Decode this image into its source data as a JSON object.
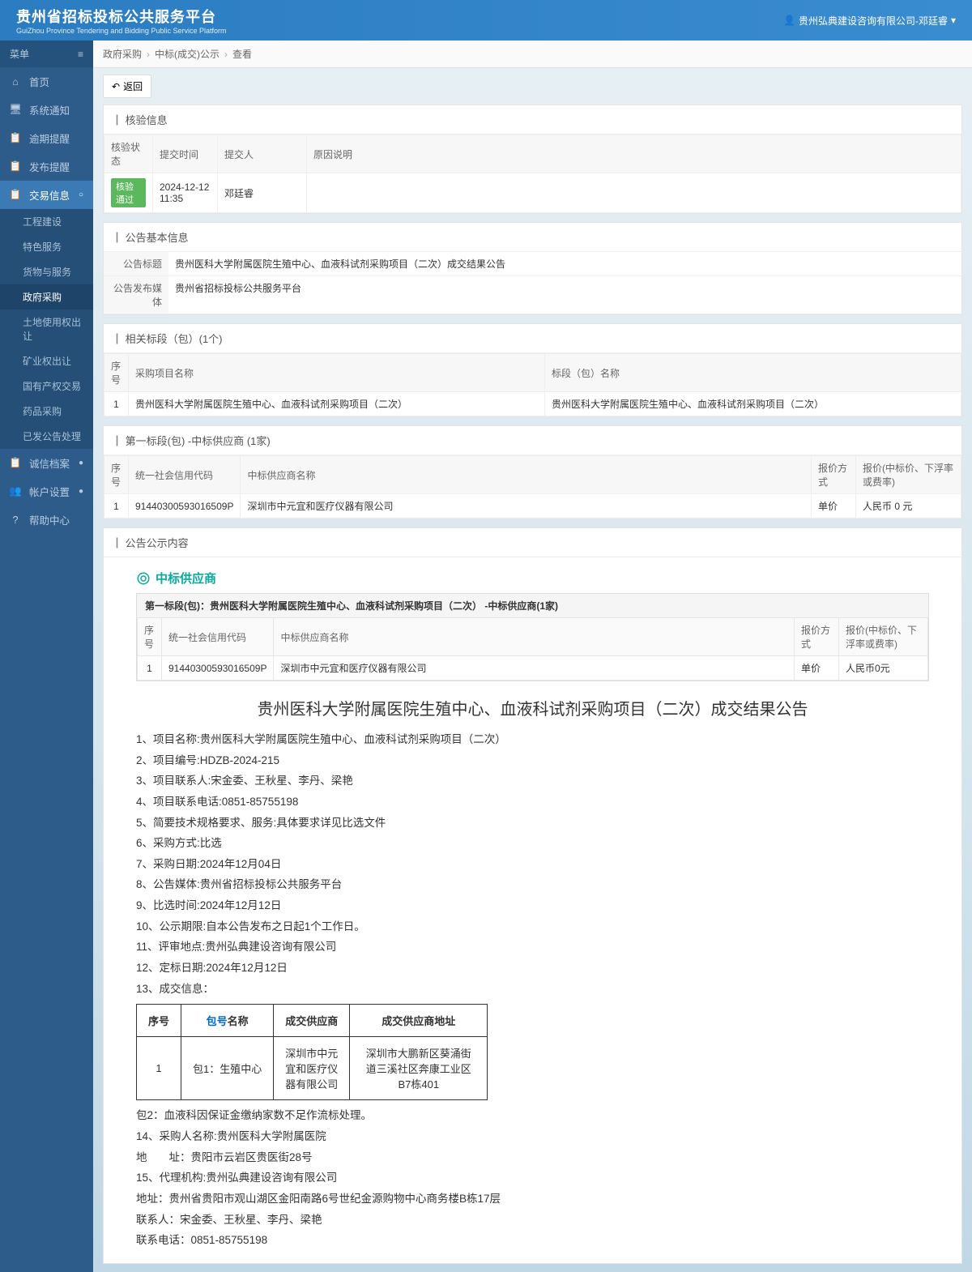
{
  "header": {
    "title": "贵州省招标投标公共服务平台",
    "subtitle": "GuiZhou Province Tendering and Bidding Public Service Platform",
    "user": "贵州弘典建设咨询有限公司-邓廷睿"
  },
  "sidebar": {
    "menuLabel": "菜单",
    "items": [
      {
        "label": "首页"
      },
      {
        "label": "系统通知"
      },
      {
        "label": "逾期提醒"
      },
      {
        "label": "发布提醒"
      },
      {
        "label": "交易信息",
        "active": true,
        "expand": "○"
      },
      {
        "label": "诚信档案",
        "expand": "●"
      },
      {
        "label": "帐户设置",
        "expand": "●"
      },
      {
        "label": "帮助中心"
      }
    ],
    "submenu": [
      {
        "label": "工程建设"
      },
      {
        "label": "特色服务"
      },
      {
        "label": "货物与服务"
      },
      {
        "label": "政府采购",
        "active": true
      },
      {
        "label": "土地使用权出让"
      },
      {
        "label": "矿业权出让"
      },
      {
        "label": "国有产权交易"
      },
      {
        "label": "药品采购"
      },
      {
        "label": "已发公告处理"
      }
    ]
  },
  "breadcrumb": [
    "政府采购",
    "中标(成交)公示",
    "查看"
  ],
  "backBtn": "返回",
  "verify": {
    "title": "核验信息",
    "headers": [
      "核验状态",
      "提交时间",
      "提交人",
      "原因说明"
    ],
    "row": {
      "status": "核验通过",
      "time": "2024-12-12 11:35",
      "person": "邓廷睿",
      "reason": ""
    }
  },
  "basic": {
    "title": "公告基本信息",
    "rows": [
      {
        "label": "公告标题",
        "value": "贵州医科大学附属医院生殖中心、血液科试剂采购项目（二次）成交结果公告"
      },
      {
        "label": "公告发布媒体",
        "value": "贵州省招标投标公共服务平台"
      }
    ]
  },
  "sections": {
    "title": "相关标段（包）(1个)",
    "headers": [
      "序号",
      "采购项目名称",
      "标段（包）名称"
    ],
    "row": [
      "1",
      "贵州医科大学附属医院生殖中心、血液科试剂采购项目（二次）",
      "贵州医科大学附属医院生殖中心、血液科试剂采购项目（二次）"
    ]
  },
  "winner": {
    "title": "第一标段(包) -中标供应商 (1家)",
    "headers": [
      "序号",
      "统一社会信用代码",
      "中标供应商名称",
      "报价方式",
      "报价(中标价、下浮率或费率)"
    ],
    "row": [
      "1",
      "91440300593016509P",
      "深圳市中元宜和医疗仪器有限公司",
      "单价",
      "人民币 0 元"
    ]
  },
  "publish": {
    "title": "公告公示内容",
    "supplierBadge": "中标供应商",
    "boxTitle": "第一标段(包)：贵州医科大学附属医院生殖中心、血液科试剂采购项目（二次） -中标供应商(1家)",
    "headers": [
      "序号",
      "统一社会信用代码",
      "中标供应商名称",
      "报价方式",
      "报价(中标价、下浮率或费率)"
    ],
    "row": [
      "1",
      "91440300593016509P",
      "深圳市中元宜和医疗仪器有限公司",
      "单价",
      "人民币0元"
    ]
  },
  "doc": {
    "title": "贵州医科大学附属医院生殖中心、血液科试剂采购项目（二次）成交结果公告",
    "lines": [
      "1、项目名称:贵州医科大学附属医院生殖中心、血液科试剂采购项目（二次）",
      "2、项目编号:HDZB-2024-215",
      "3、项目联系人:宋金委、王秋星、李丹、梁艳",
      "4、项目联系电话:0851-85755198",
      "5、简要技术规格要求、服务:具体要求详见比选文件",
      "6、采购方式:比选",
      "7、采购日期:2024年12月04日",
      "8、公告媒体:贵州省招标投标公共服务平台",
      "9、比选时间:2024年12月12日",
      "10、公示期限:自本公告发布之日起1个工作日。",
      "11、评审地点:贵州弘典建设咨询有限公司",
      "12、定标日期:2024年12月12日",
      "13、成交信息："
    ],
    "dealHeaders": [
      "序号",
      "名称",
      "成交供应商",
      "成交供应商地址"
    ],
    "dealPkgLabel": "包号",
    "dealRow": [
      "1",
      "包1：生殖中心",
      "深圳市中元宜和医疗仪器有限公司",
      "深圳市大鹏新区葵涌街道三溪社区奔康工业区B7栋401"
    ],
    "footer": [
      "包2：血液科因保证金缴纳家数不足作流标处理。",
      "14、采购人名称:贵州医科大学附属医院",
      "地　　址：贵阳市云岩区贵医街28号",
      "15、代理机构:贵州弘典建设咨询有限公司",
      "地址：贵州省贵阳市观山湖区金阳南路6号世纪金源购物中心商务楼B栋17层",
      "联系人：宋金委、王秋星、李丹、梁艳",
      "联系电话：0851-85755198"
    ]
  }
}
